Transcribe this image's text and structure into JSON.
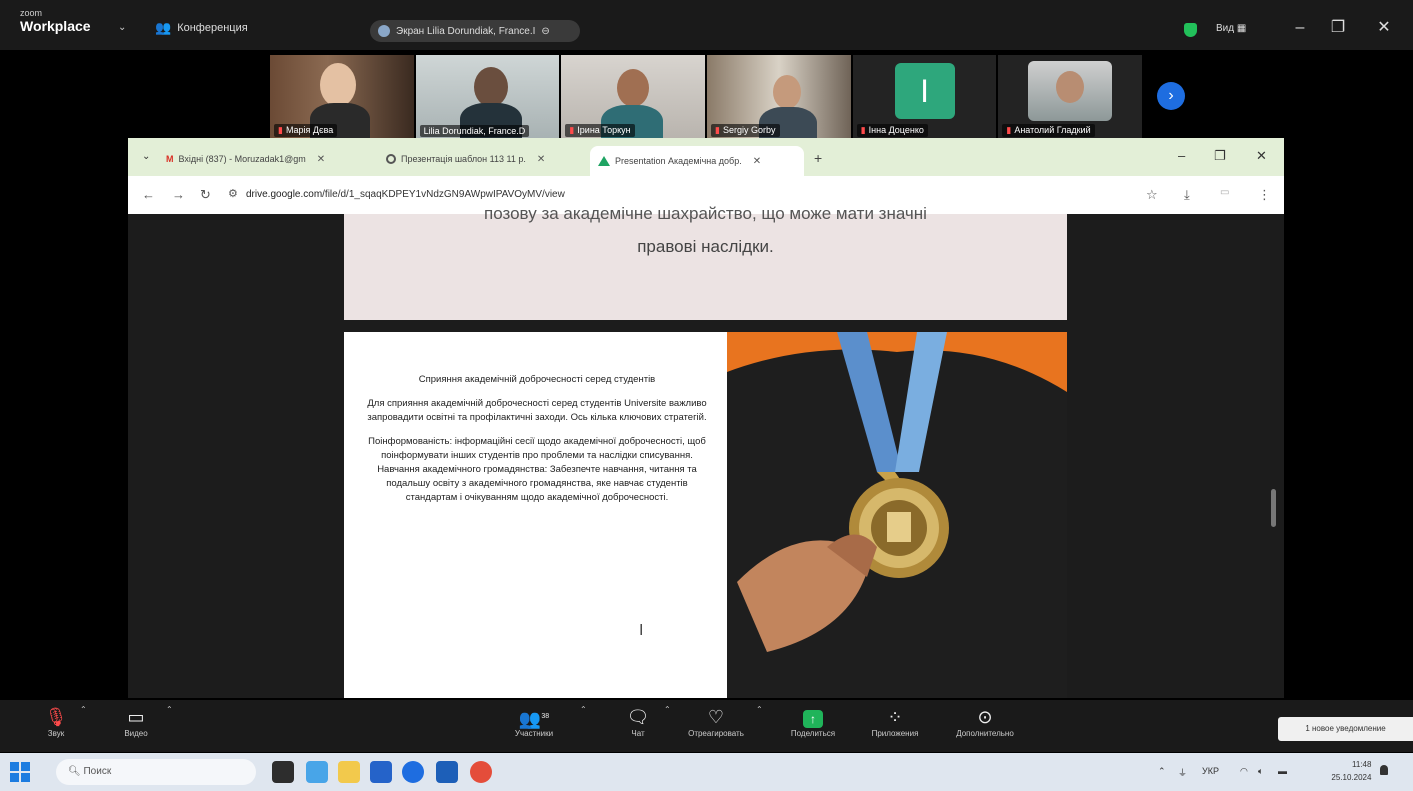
{
  "zoom": {
    "logo_small": "zoom",
    "logo_big": "Workplace",
    "conference_menu": "Конференция",
    "share_status": "Экран Lilia Dorundiak, France.I",
    "view_menu": "Вид",
    "participants": [
      {
        "name": "Марія Дєва",
        "muted": true
      },
      {
        "name": "Lilia Dorundiak, France.D",
        "muted": false,
        "active": true
      },
      {
        "name": "Ірина Торкун",
        "muted": true
      },
      {
        "name": "Sergiy Gorby",
        "muted": true
      },
      {
        "name": "Інна Доценко",
        "muted": true,
        "initial": "I"
      },
      {
        "name": "Анатолий Гладкий",
        "muted": true
      }
    ],
    "controls": {
      "audio": "Звук",
      "video": "Видео",
      "participants": "Участники",
      "participants_count": "38",
      "chat": "Чат",
      "react": "Отреагировать",
      "share": "Поделиться",
      "apps": "Приложения",
      "more": "Дополнительно",
      "notification": "1 новое уведомление"
    }
  },
  "browser": {
    "tabs": [
      {
        "title": "Вхідні (837) - Moruzadak1@gm",
        "active": false
      },
      {
        "title": "Презентація шаблон 113 11 р.",
        "active": false
      },
      {
        "title": "Presentation Академічна добр.",
        "active": true
      }
    ],
    "new_tab": "+",
    "url_host": "drive.google.com",
    "url_path": "/file/d/1_sqaqKDPEY1vNdzGN9AWpwIPAVOyMV/view"
  },
  "slide": {
    "top_text_cut": "позову за академічне шахрайство, що може мати значні",
    "top_text_line2": "правові наслідки.",
    "paragraphs": [
      "Сприяння академічній доброчесності серед студентів",
      "Для сприяння академічній доброчесності серед студентів Universite важливо запровадити освітні та профілактичні заходи. Ось кілька ключових стратегій.",
      "Поінформованість: інформаційні сесії щодо академічної доброчесності, щоб поінформувати інших студентів про проблеми та наслідки списування.",
      "Навчання академічного громадянства: Забезпечте навчання, читання та подальшу освіту з академічного громадянства, яке навчає студентів стандартам і очікуванням щодо академічної доброчесності."
    ]
  },
  "taskbar": {
    "search_placeholder": "Поиск",
    "language": "УКР",
    "time": "11:48",
    "date": "25.10.2024"
  },
  "colors": {
    "zoom_bg": "#1a1a1a",
    "active_speaker": "#36d47a",
    "share_green": "#20b45a",
    "tab_bar": "#e3efd7",
    "slide_pink": "#ece3e3"
  }
}
